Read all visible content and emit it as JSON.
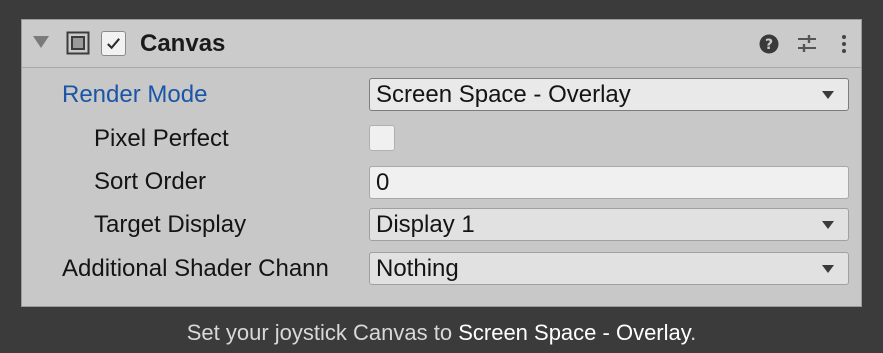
{
  "component": {
    "title": "Canvas",
    "enabled": true,
    "icons": [
      "foldout-arrow-icon",
      "canvas-component-icon",
      "help-icon",
      "preset-sliders-icon",
      "more-menu-icon"
    ]
  },
  "fields": {
    "render_mode": {
      "label": "Render Mode",
      "value": "Screen Space - Overlay"
    },
    "pixel_perfect": {
      "label": "Pixel Perfect",
      "checked": false
    },
    "sort_order": {
      "label": "Sort Order",
      "value": "0"
    },
    "target_display": {
      "label": "Target Display",
      "value": "Display 1"
    },
    "additional_shader_channels": {
      "label": "Additional Shader Chann",
      "value": "Nothing"
    }
  },
  "caption": {
    "prefix": "Set your joystick Canvas to ",
    "highlight": "Screen Space - Overlay",
    "suffix": "."
  },
  "colors": {
    "background": "#3b3b3b",
    "panel": "#c8c8c8",
    "accent_label": "#1a55a8"
  }
}
